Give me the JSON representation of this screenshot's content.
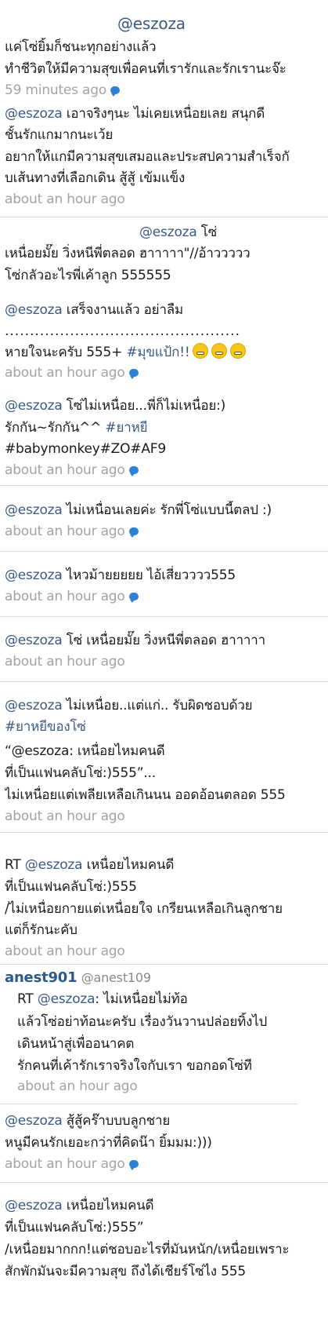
{
  "tweets": [
    {
      "mention": "@eszoza",
      "lines": [
        "แค่โซ่ยิ้มก็ชนะทุกอย่างแล้ว",
        "ทำชีวิตให้มีความสุขเพื่อคนที่เรารักและรักเรานะจ๊ะ"
      ],
      "time": "59 minutes ago"
    },
    {
      "mention": "@eszoza",
      "first": " เอาจริงๆนะ ไม่เคยเหนื่อยเลย สนุกดี",
      "lines": [
        "ชั้นรักแกมากนะเว้ย",
        "อยากให้แกมีความสุขเสมอและประสปความสำเร็จกั",
        "บเส้นทางที่เลือกเดิน สู้สู้ เข้มแข็ง"
      ],
      "time": "about an hour ago"
    },
    {
      "mention": "@eszoza",
      "first": " โซ่",
      "lines": [
        "เหนื่อยมั๊ย วิ่งหนีพี่ตลอด ฮาาาาา\"//อ้าววววว",
        "โซ่กลัวอะไรพี่เค้าลูก 555555"
      ],
      "time": ""
    },
    {
      "mention": "@eszoza",
      "first": " เสร็จงานแล้ว อย่าลืม",
      "dots": "...............................................",
      "lines": [
        "หายใจนะครับ 555+ "
      ],
      "tag": "#มุขแป้ก!!",
      "time": "about an hour ago"
    },
    {
      "mention": "@eszoza",
      "first": " โซ่ไม่เหนื่อย...พี่ก็ไม่เหนื่อย:)",
      "line2a": "รักกัน~รักกัน^^ ",
      "tag": "#ยาหยี",
      "lines": [
        "#babymonkey#ZO#AF9"
      ],
      "time": "about an hour ago"
    },
    {
      "mention": "@eszoza",
      "first": "  ไม่เหนื่อนเลยค่ะ รักพี่โซ่แบบนี้ตลป :)",
      "time": "about an hour ago"
    },
    {
      "mention": "@eszoza",
      "first": " ไหวม้ายยยยย ไอ้เสี่ยวววว555",
      "time": "about an hour ago"
    },
    {
      "mention": "@eszoza",
      "first": " โซ่ เหนื่อยมั๊ย วิ่งหนีพี่ตลอด ฮาาาาา",
      "time": "about an hour ago"
    },
    {
      "mention": "@eszoza",
      "first": " ไม่เหนื่อย..แต่แก่.. รับผิดชอบด้วย",
      "tag": "#ยาหยีของโซ่",
      "lines": [
        "“@eszoza: เหนื่อยไหมคนดี",
        "ที่เป็นแฟนคลับโซ่:)555”...",
        "ไม่เหนื่อยแต่เพลียเหลือเกินนน ออดอ้อนตลอด 555"
      ],
      "time": "about an hour ago"
    },
    {
      "rt": "RT ",
      "mention": "@eszoza",
      "first": " เหนื่อยไหมคนดี",
      "lines": [
        "ที่เป็นแฟนคลับโซ่:)555",
        "/ไม่เหนื่อยกายแต่เหนื่อยใจ เกรียนเหลือเกินลูกชาย",
        "แต่ก็รักนะคับ"
      ],
      "time": "about an hour ago"
    },
    {
      "author": "anest901",
      "handle": "@anest109",
      "rt": "RT ",
      "mention": "@eszoza",
      "first": ": ไม่เหนื่อยไม่ท้อ",
      "lines": [
        "แล้วโซ่อย่าท้อนะครับ เรื่องวันวานปล่อยทิ้งไป",
        "เดินหน้าสู่เพื่ออนาคต",
        "รักคนที่เค้ารักเราจริงใจกับเรา ขอกอดโซ่ที"
      ],
      "time": "about an hour ago"
    },
    {
      "mention": "@eszoza",
      "first": " สู้สู้คร๊าบบบลูกชาย",
      "lines": [
        "หนูมีคนรักเยอะกว่าที่คิดน๊า ยิ้มมม:)))"
      ],
      "time": "about an hour ago"
    },
    {
      "mention": "@eszoza",
      "first": " เหนื่อยไหมคนดี",
      "lines": [
        "ที่เป็นแฟนคลับโซ่:)555”",
        "/เหนื่อยมากกก!แต่ชอบอะไรที่มันหนัก/เหนื่อยเพราะ",
        "สักพักมันจะมีความสุข ถึงได้เชียร์โซ่ไง 555"
      ],
      "time": ""
    }
  ],
  "icons": {
    "reply": "chat-bubble-icon",
    "emoji": "grinning-face-icon"
  },
  "colors": {
    "mention": "#3a5a86",
    "timestamp": "#a3a3a3",
    "author": "#2b5a8a",
    "bubble": "#2f7fd6"
  }
}
